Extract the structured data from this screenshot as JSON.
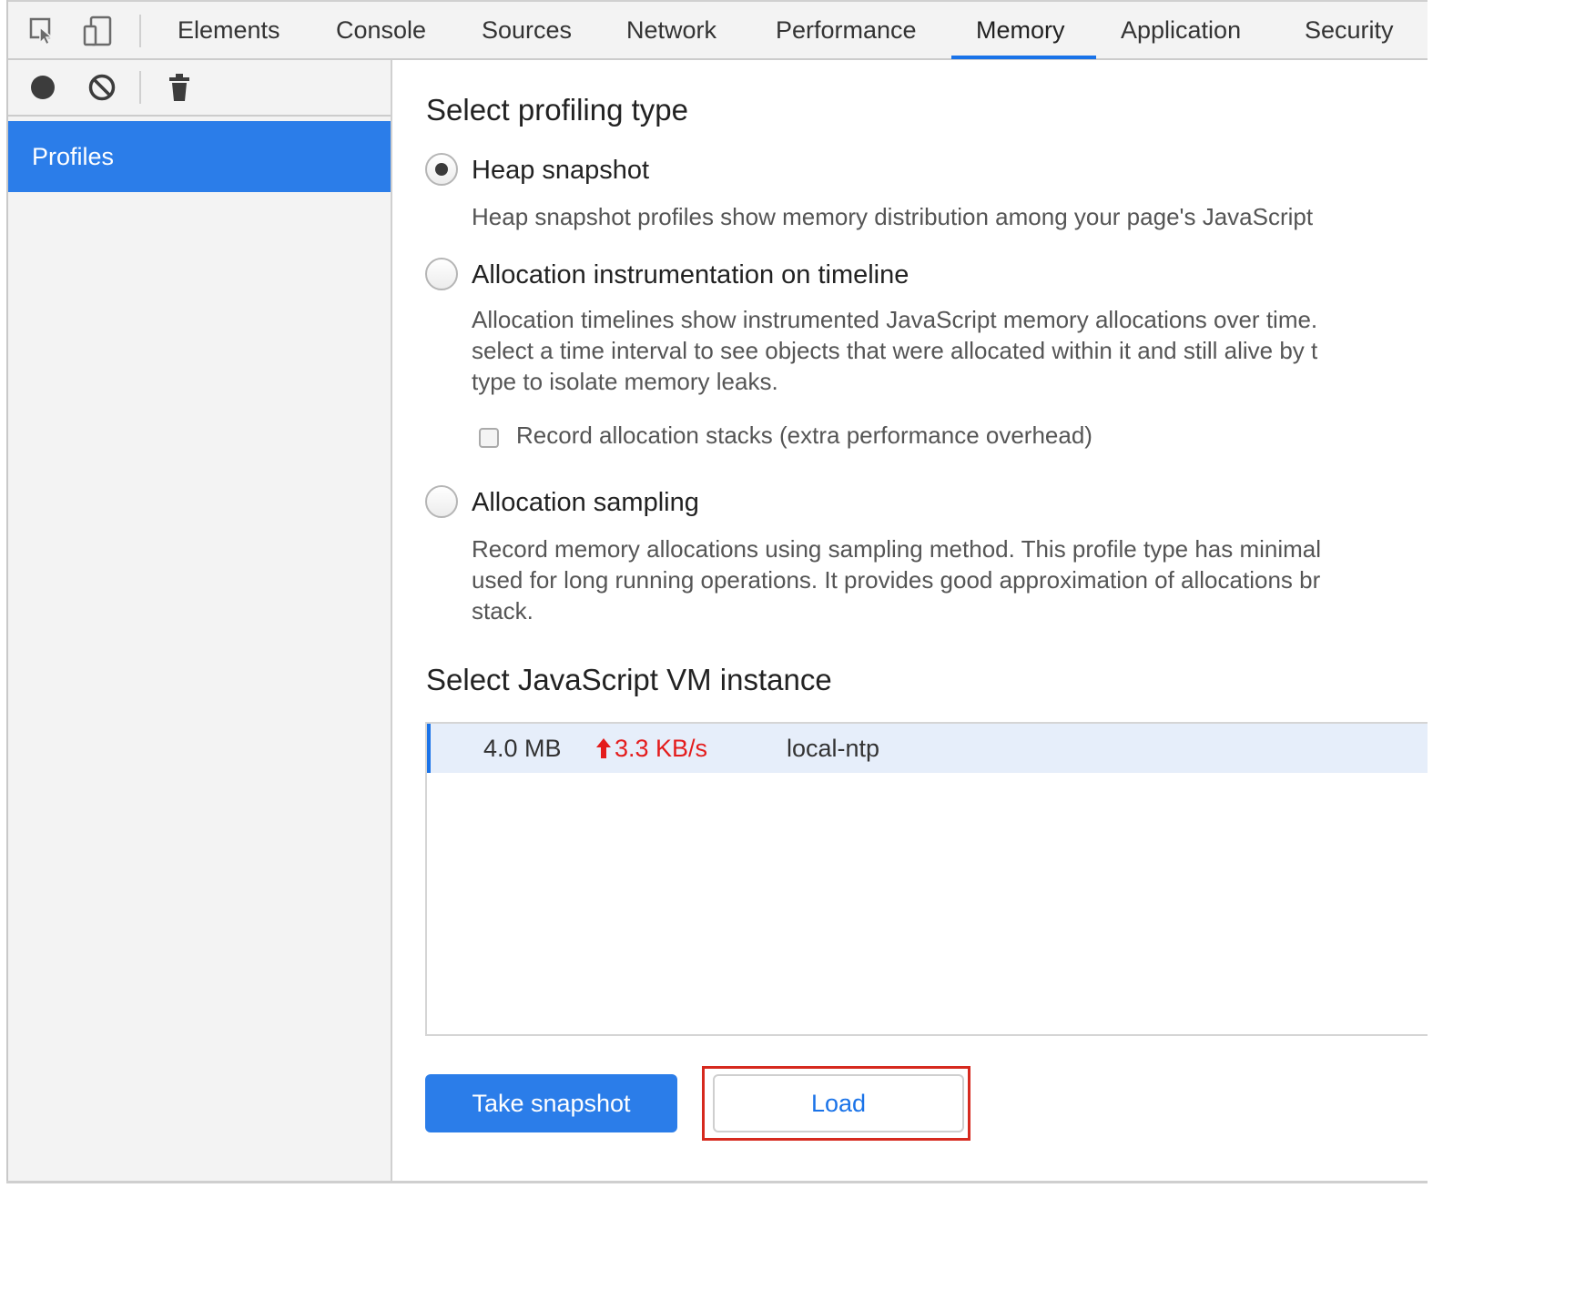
{
  "tabs": [
    {
      "label": "Elements"
    },
    {
      "label": "Console"
    },
    {
      "label": "Sources"
    },
    {
      "label": "Network"
    },
    {
      "label": "Performance"
    },
    {
      "label": "Memory",
      "active": true
    },
    {
      "label": "Application"
    },
    {
      "label": "Security"
    }
  ],
  "toolbar_icons": [
    "select-element-icon",
    "device-toolbar-icon"
  ],
  "sidebar": {
    "toolbar_icons": [
      "record-icon",
      "clear-icon",
      "trash-icon"
    ],
    "items": [
      {
        "label": "Profiles",
        "selected": true
      }
    ]
  },
  "main": {
    "profiling_title": "Select profiling type",
    "options": [
      {
        "label": "Heap snapshot",
        "checked": true,
        "description": [
          "Heap snapshot profiles show memory distribution among your page's JavaScript"
        ]
      },
      {
        "label": "Allocation instrumentation on timeline",
        "checked": false,
        "description": [
          "Allocation timelines show instrumented JavaScript memory allocations over time.",
          "select a time interval to see objects that were allocated within it and still alive by t",
          "type to isolate memory leaks."
        ],
        "checkbox_label": "Record allocation stacks (extra performance overhead)"
      },
      {
        "label": "Allocation sampling",
        "checked": false,
        "description": [
          "Record memory allocations using sampling method. This profile type has minimal",
          "used for long running operations. It provides good approximation of allocations br",
          "stack."
        ]
      }
    ],
    "vm_title": "Select JavaScript VM instance",
    "vm_instances": [
      {
        "size": "4.0 MB",
        "rate": "3.3 KB/s",
        "name": "local-ntp"
      }
    ],
    "buttons": {
      "primary": "Take snapshot",
      "secondary": "Load"
    }
  },
  "colors": {
    "accent": "#1a73e8",
    "sidebar_selected": "#2b7de9",
    "rate_up": "#e41c1c",
    "highlight": "#d6291e"
  }
}
